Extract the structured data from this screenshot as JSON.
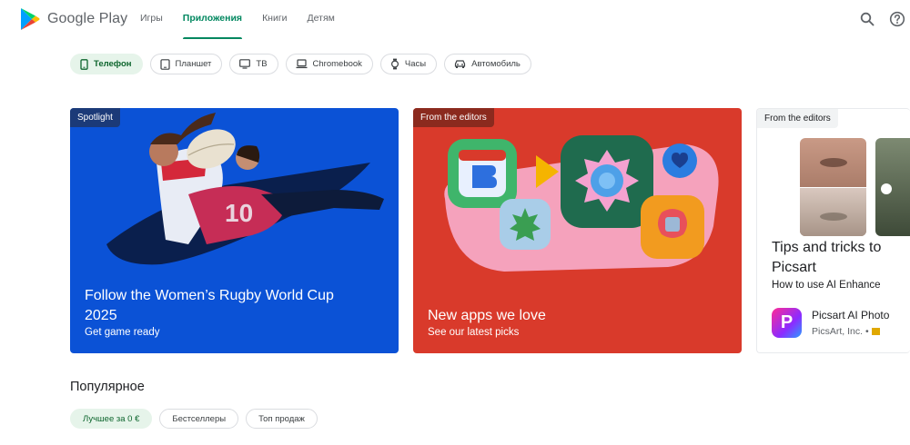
{
  "header": {
    "brand": "Google Play",
    "nav": [
      {
        "label": "Игры",
        "active": false
      },
      {
        "label": "Приложения",
        "active": true
      },
      {
        "label": "Книги",
        "active": false
      },
      {
        "label": "Детям",
        "active": false
      }
    ],
    "icons": [
      "search-icon",
      "help-icon"
    ]
  },
  "devices": [
    {
      "label": "Телефон",
      "icon": "phone-icon",
      "active": true
    },
    {
      "label": "Планшет",
      "icon": "tablet-icon",
      "active": false
    },
    {
      "label": "ТВ",
      "icon": "tv-icon",
      "active": false
    },
    {
      "label": "Chromebook",
      "icon": "laptop-icon",
      "active": false
    },
    {
      "label": "Часы",
      "icon": "watch-icon",
      "active": false
    },
    {
      "label": "Автомобиль",
      "icon": "car-icon",
      "active": false
    }
  ],
  "cards": [
    {
      "tag": "Spotlight",
      "title_line1": "Follow the Women’s Rugby World Cup",
      "title_line2": "2025",
      "subtitle": "Get game ready"
    },
    {
      "tag": "From the editors",
      "title": "New apps we love",
      "subtitle": "See our latest picks"
    },
    {
      "tag": "From the editors",
      "title_line1": "Tips and tricks to",
      "title_line2": "Picsart",
      "subtitle": "How to use AI Enhance",
      "app_name": "Picsart AI Photo",
      "app_dev": "PicsArt, Inc.",
      "app_icon_letter": "P"
    }
  ],
  "popular": {
    "title": "Популярное",
    "filters": [
      {
        "label": "Лучшее за 0 €",
        "active": true
      },
      {
        "label": "Бестселлеры",
        "active": false
      },
      {
        "label": "Топ продаж",
        "active": false
      }
    ]
  },
  "colors": {
    "accent": "#01875f",
    "chip_active_bg": "#e6f4ea",
    "card1_bg": "#0b52d6",
    "card2_bg": "#d93a2b"
  }
}
